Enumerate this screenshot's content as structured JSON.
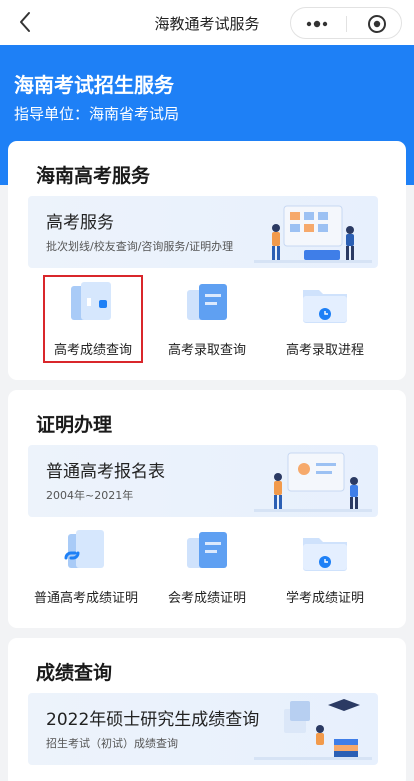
{
  "topbar": {
    "title": "海教通考试服务"
  },
  "header": {
    "title": "海南考试招生服务",
    "subtitle": "指导单位：海南省考试局"
  },
  "sections": {
    "gaokao": {
      "title": "海南高考服务",
      "banner": {
        "title": "高考服务",
        "subtitle": "批次划线/校友查询/咨询服务/证明办理"
      },
      "items": [
        {
          "label": "高考成绩查询",
          "icon": "score-report-icon"
        },
        {
          "label": "高考录取查询",
          "icon": "admission-docs-icon"
        },
        {
          "label": "高考录取进程",
          "icon": "folder-clock-icon"
        }
      ]
    },
    "certificate": {
      "title": "证明办理",
      "banner": {
        "title": "普通高考报名表",
        "subtitle": "2004年~2021年"
      },
      "items": [
        {
          "label": "普通高考成绩证明",
          "icon": "linked-doc-icon"
        },
        {
          "label": "会考成绩证明",
          "icon": "docs-stack-icon"
        },
        {
          "label": "学考成绩证明",
          "icon": "folder-clock-icon"
        }
      ]
    },
    "scores": {
      "title": "成绩查询",
      "banner": {
        "title": "2022年硕士研究生成绩查询",
        "subtitle": "招生考试（初试）成绩查询"
      }
    }
  }
}
